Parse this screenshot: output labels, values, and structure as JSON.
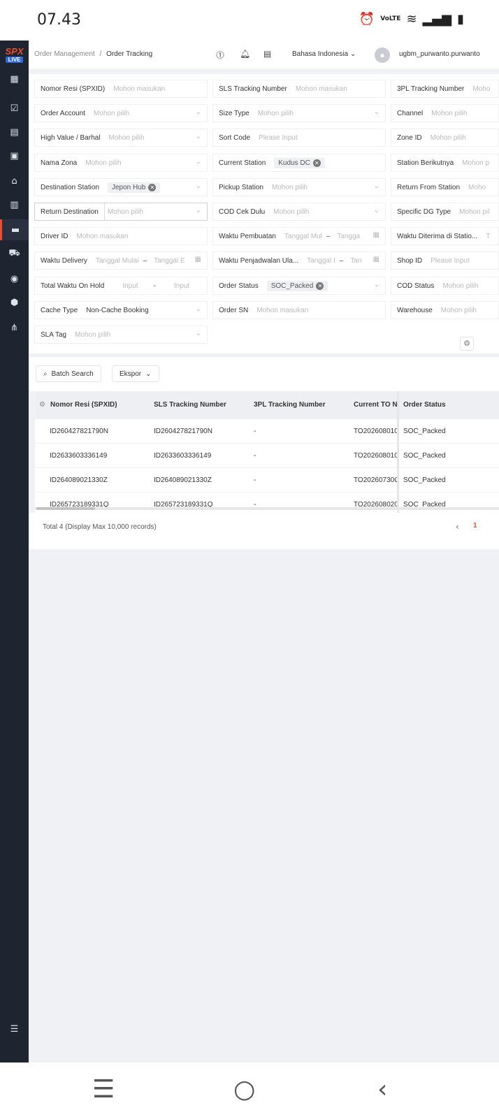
{
  "status_bar": {
    "time": "07.43",
    "volte": "VoLTE",
    "icons": [
      "alarm-icon",
      "wifi-icon",
      "signal-icon",
      "battery-icon"
    ]
  },
  "logo": {
    "brand": "SPX",
    "badge": "LIVE"
  },
  "breadcrumb": {
    "parent": "Order Management",
    "separator": "/",
    "current": "Order Tracking"
  },
  "header": {
    "language": "Bahasa Indonesia",
    "username": "ugbm_purwanto.purwanto"
  },
  "filters": {
    "nomor_resi": {
      "label": "Nomor Resi (SPXID)",
      "placeholder": "Mohon masukan"
    },
    "sls_tracking": {
      "label": "SLS Tracking Number",
      "placeholder": "Mohon masukan"
    },
    "tpl_tracking": {
      "label": "3PL Tracking Number",
      "placeholder": "Moho"
    },
    "order_account": {
      "label": "Order Account",
      "placeholder": "Mohon pilih"
    },
    "size_type": {
      "label": "Size Type",
      "placeholder": "Mohon pilih"
    },
    "channel": {
      "label": "Channel",
      "placeholder": "Mohon pilih"
    },
    "high_value": {
      "label": "High Value / Barhal",
      "placeholder": "Mohon pilih"
    },
    "sort_code": {
      "label": "Sort Code",
      "placeholder": "Please Input"
    },
    "zone_id": {
      "label": "Zone ID",
      "placeholder": "Mohon pilih"
    },
    "nama_zona": {
      "label": "Nama Zona",
      "placeholder": "Mohon pilih"
    },
    "current_station": {
      "label": "Current Station",
      "value": "Kudus DC"
    },
    "station_berikutnya": {
      "label": "Station Berikutnya",
      "placeholder": "Mohon p"
    },
    "destination_station": {
      "label": "Destination Station",
      "value": "Jepon Hub"
    },
    "pickup_station": {
      "label": "Pickup Station",
      "placeholder": "Mohon pilih"
    },
    "return_from_station": {
      "label": "Return From Station",
      "placeholder": "Moho"
    },
    "return_destination": {
      "label": "Return Destination",
      "placeholder": "Mohon pilih"
    },
    "cod_cek_dulu": {
      "label": "COD Cek Dulu",
      "placeholder": "Mohon pilih"
    },
    "specific_dg_type": {
      "label": "Specific DG Type",
      "placeholder": "Mohon pil"
    },
    "driver_id": {
      "label": "Driver ID",
      "placeholder": "Mohon masukan"
    },
    "waktu_pembuatan": {
      "label": "Waktu Pembuatan",
      "start": "Tanggal Mul",
      "end": "Tangga"
    },
    "waktu_diterima": {
      "label": "Waktu Diterima di Statio...",
      "extra": "T"
    },
    "waktu_delivery": {
      "label": "Waktu Delivery",
      "start": "Tanggal Mulai",
      "end": "Tanggal E"
    },
    "waktu_penjadwalan": {
      "label": "Waktu Penjadwalan Ula...",
      "start": "Tanggal I",
      "end": "Tan"
    },
    "shop_id": {
      "label": "Shop ID",
      "placeholder": "Please Input"
    },
    "total_waktu_on_hold": {
      "label": "Total Waktu On Hold",
      "min": "Input",
      "max": "Input"
    },
    "order_status": {
      "label": "Order Status",
      "value": "SOC_Packed"
    },
    "cod_status": {
      "label": "COD Status",
      "placeholder": "Mohon pilih"
    },
    "cache_type": {
      "label": "Cache Type",
      "value": "Non-Cache Booking"
    },
    "order_sn": {
      "label": "Order SN",
      "placeholder": "Mohon masukan"
    },
    "warehouse": {
      "label": "Warehouse",
      "placeholder": "Mohon pilih"
    },
    "sla_tag": {
      "label": "SLA Tag",
      "placeholder": "Mohon pilih"
    },
    "range_sep": "–",
    "min_max_sep": "-"
  },
  "actions": {
    "batch_search": "Batch Search",
    "export": "Ekspor"
  },
  "table": {
    "columns": [
      "Nomor Resi (SPXID)",
      "SLS Tracking Number",
      "3PL Tracking Number",
      "Current TO Nu",
      "Order Status"
    ],
    "rows": [
      [
        "ID260427821790N",
        "ID260427821790N",
        "-",
        "TO202608010",
        "SOC_Packed"
      ],
      [
        "ID2633603336149",
        "ID2633603336149",
        "-",
        "TO202608010",
        "SOC_Packed"
      ],
      [
        "ID264089021330Z",
        "ID264089021330Z",
        "-",
        "TO20260730Q",
        "SOC_Packed"
      ],
      [
        "ID265723189331Q",
        "ID265723189331Q",
        "-",
        "TO202608020",
        "SOC_Packed"
      ]
    ]
  },
  "pagination": {
    "total": "Total 4 (Display Max 10,000 records)",
    "current_page": "1",
    "prev": "‹"
  }
}
